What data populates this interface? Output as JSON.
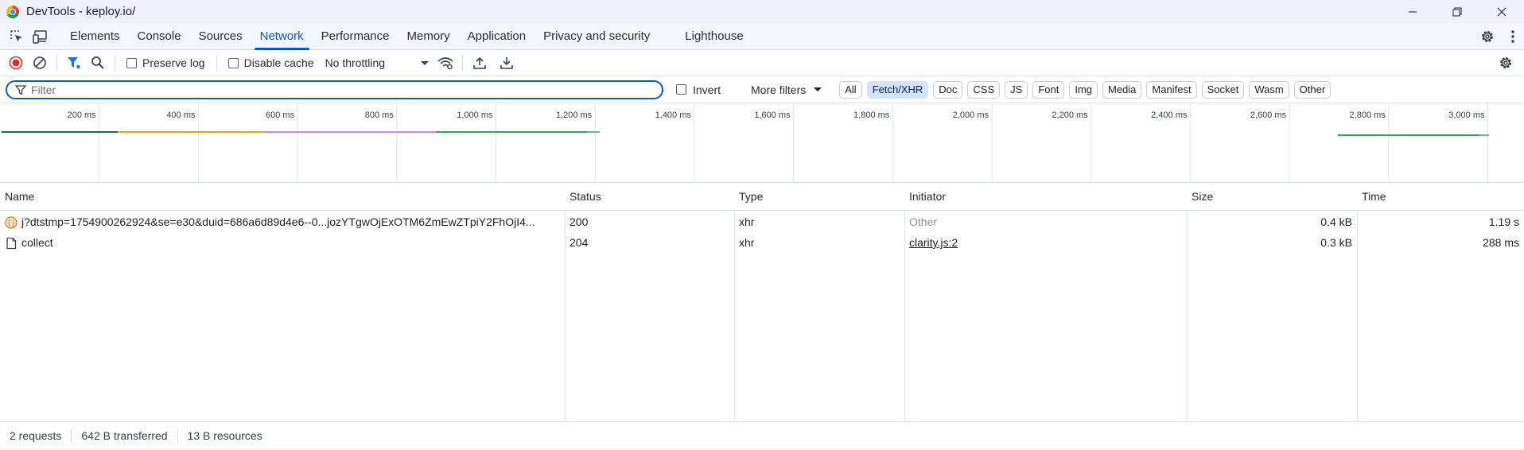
{
  "window": {
    "title": "DevTools - keploy.io/",
    "controls": [
      "minimize",
      "restore",
      "close"
    ]
  },
  "tabs": {
    "items": [
      {
        "label": "Elements",
        "active": false
      },
      {
        "label": "Console",
        "active": false
      },
      {
        "label": "Sources",
        "active": false
      },
      {
        "label": "Network",
        "active": true
      },
      {
        "label": "Performance",
        "active": false
      },
      {
        "label": "Memory",
        "active": false
      },
      {
        "label": "Application",
        "active": false
      },
      {
        "label": "Privacy and security",
        "active": false
      },
      {
        "label": "Lighthouse",
        "active": false
      }
    ]
  },
  "toolbar": {
    "preserve_log": "Preserve log",
    "preserve_log_checked": false,
    "disable_cache": "Disable cache",
    "disable_cache_checked": false,
    "throttling": "No throttling"
  },
  "filterbar": {
    "placeholder": "Filter",
    "invert": "Invert",
    "invert_checked": false,
    "more_filters": "More filters",
    "chips": [
      {
        "label": "All",
        "active": false
      },
      {
        "label": "Fetch/XHR",
        "active": true
      },
      {
        "label": "Doc",
        "active": false
      },
      {
        "label": "CSS",
        "active": false
      },
      {
        "label": "JS",
        "active": false
      },
      {
        "label": "Font",
        "active": false
      },
      {
        "label": "Img",
        "active": false
      },
      {
        "label": "Media",
        "active": false
      },
      {
        "label": "Manifest",
        "active": false
      },
      {
        "label": "Socket",
        "active": false
      },
      {
        "label": "Wasm",
        "active": false
      },
      {
        "label": "Other",
        "active": false
      }
    ]
  },
  "overview": {
    "ticks": [
      "200 ms",
      "400 ms",
      "600 ms",
      "800 ms",
      "1,000 ms",
      "1,200 ms",
      "1,400 ms",
      "1,600 ms",
      "1,800 ms",
      "2,000 ms",
      "2,200 ms",
      "2,400 ms",
      "2,600 ms",
      "2,800 ms",
      "3,000 ms"
    ],
    "colors": {
      "green": "#34a853",
      "orange": "#f2a60c",
      "purple": "#c58af9",
      "blue": "#6ea6f5",
      "teal": "#137333"
    }
  },
  "table": {
    "headers": {
      "name": "Name",
      "status": "Status",
      "type": "Type",
      "initiator": "Initiator",
      "size": "Size",
      "time": "Time"
    },
    "rows": [
      {
        "icon": "xhr-icon",
        "name": "j?dtstmp=1754900262924&se=e30&duid=686a6d89d4e6--0...jozYTgwOjExOTM6ZmEwZTpiY2FhOjI4...",
        "status": "200",
        "type": "xhr",
        "initiator": "Other",
        "size": "0.4 kB",
        "time": "1.19 s"
      },
      {
        "icon": "document-icon",
        "name": "collect",
        "status": "204",
        "type": "xhr",
        "initiator": "clarity.js:2",
        "size": "0.3 kB",
        "time": "288 ms"
      }
    ]
  },
  "status": {
    "requests": "2 requests",
    "transferred": "642 B transferred",
    "resources": "13 B resources"
  }
}
